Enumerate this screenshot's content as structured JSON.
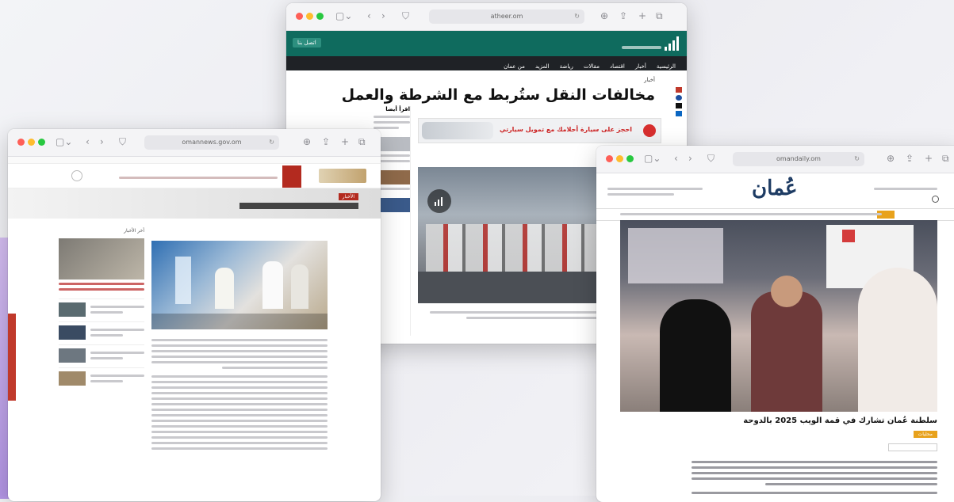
{
  "center_window": {
    "url": "atheer.om",
    "top_button": "اتصل بنا",
    "nav": [
      "الرئيسية",
      "أخبار",
      "اقتصاد",
      "مقالات",
      "رياضة",
      "المزيد",
      "من عمان"
    ],
    "breadcrumb": "أخبار",
    "headline": "مخالفات النقل ستُربط مع الشرطة والعمل",
    "ad_text": "احجز على سيارة أحلامك مع تمويل سيارتي",
    "sidebar_title": "اقرأ أيضا"
  },
  "left_window": {
    "url": "omannews.gov.om",
    "section_badge": "الأخبار",
    "sidebar_title": "أخر الأخبار",
    "colors": {
      "accent": "#b32a1f"
    }
  },
  "right_window": {
    "url": "omandaily.om",
    "logo": "عُمان",
    "article_title": "سلطنة عُمان تشارك في قمة الويب 2025 بالدوحة",
    "tag": "محليات",
    "colors": {
      "accent": "#e8a21c"
    }
  },
  "colors": {
    "athir_green": "#0f6b5e",
    "athir_dark": "#1f2226"
  }
}
